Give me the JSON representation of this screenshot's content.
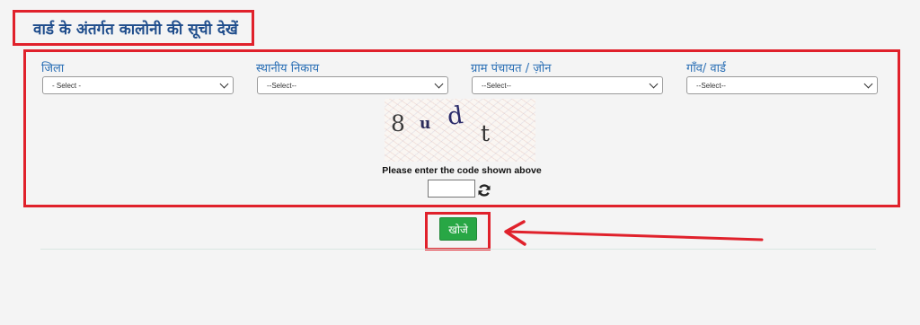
{
  "page_title": "वार्ड के अंतर्गत कालोनी की सूची देखें",
  "fields": [
    {
      "label": "जिला",
      "selected": "- Select -"
    },
    {
      "label": "स्थानीय निकाय",
      "selected": "--Select--"
    },
    {
      "label": "ग्राम पंचायत / ज़ोन",
      "selected": "--Select--"
    },
    {
      "label": "गाँव/ वार्ड",
      "selected": "--Select--"
    }
  ],
  "captcha": {
    "chars": [
      "8",
      "u",
      "d",
      "t"
    ],
    "prompt": "Please enter the code shown above",
    "input_value": ""
  },
  "search_button": {
    "label": "खोजे"
  },
  "colors": {
    "highlight": "#e0212b",
    "title": "#1f4d8c",
    "label": "#2a6fb5",
    "button": "#28a745"
  },
  "icons": [
    "refresh-icon",
    "chevron-down-icon",
    "arrow-icon"
  ]
}
